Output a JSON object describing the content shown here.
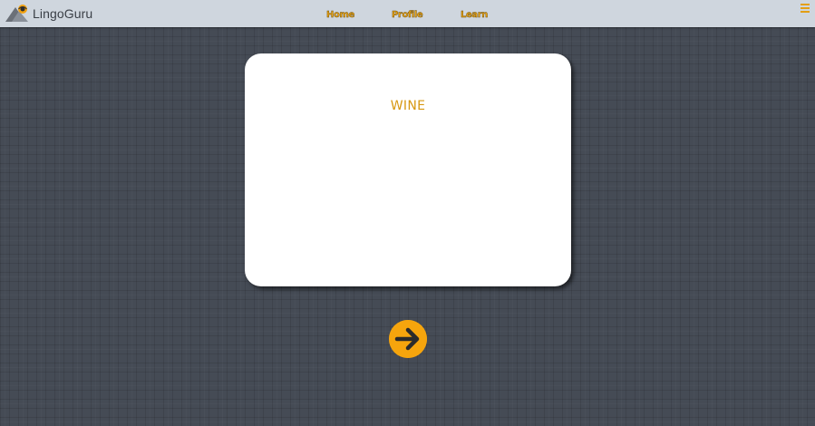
{
  "app": {
    "name": "LingoGuru"
  },
  "nav": {
    "items": [
      {
        "label": "Home"
      },
      {
        "label": "Profile"
      },
      {
        "label": "Learn"
      }
    ]
  },
  "flashcard": {
    "word": "WINE"
  },
  "icons": {
    "logo": "mountain-globe-logo-icon",
    "menu": "hamburger-menu-icon",
    "next": "arrow-right-circle-icon"
  },
  "colors": {
    "accent": "#f6a50d",
    "nav_text": "#e39f14",
    "topbar": "#cfd6de",
    "background": "#454b55",
    "card": "#ffffff"
  }
}
